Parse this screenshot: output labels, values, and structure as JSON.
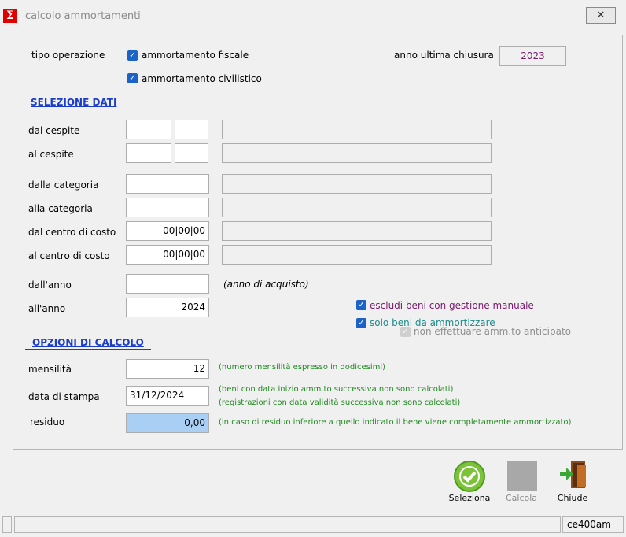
{
  "window": {
    "title": "calcolo ammortamenti",
    "icon_glyph": "Σ",
    "close_glyph": "✕"
  },
  "tipo_operazione": {
    "label": "tipo operazione",
    "fiscale": {
      "label": "ammortamento fiscale",
      "checked": true
    },
    "civilistico": {
      "label": "ammortamento civilistico",
      "checked": true
    }
  },
  "anno_ultima_chiusura": {
    "label": "anno ultima chiusura",
    "value": "2023"
  },
  "selezione_dati": {
    "title": "SELEZIONE DATI",
    "dal_cespite": {
      "label": "dal cespite",
      "value1": "",
      "value2": ""
    },
    "al_cespite": {
      "label": "al cespite",
      "value1": "",
      "value2": ""
    },
    "dalla_categoria": {
      "label": "dalla categoria",
      "value": ""
    },
    "alla_categoria": {
      "label": "alla categoria",
      "value": ""
    },
    "dal_centro_costo": {
      "label": "dal centro di costo",
      "value": "00|00|00"
    },
    "al_centro_costo": {
      "label": "al centro di costo",
      "value": "00|00|00"
    },
    "dall_anno": {
      "label": "dall'anno",
      "value": "",
      "hint": "(anno di acquisto)"
    },
    "all_anno": {
      "label": "all'anno",
      "value": "2024"
    },
    "escludi_manuale": {
      "label": "escludi beni con gestione manuale",
      "checked": true
    },
    "solo_ammortizzare": {
      "label": "solo beni da ammortizzare",
      "checked": true
    },
    "non_anticipato": {
      "label": "non effettuare amm.to anticipato",
      "checked": true,
      "disabled": true
    }
  },
  "opzioni_calcolo": {
    "title": "OPZIONI DI CALCOLO",
    "mensilita": {
      "label": "mensilità",
      "value": "12",
      "note": "(numero mensilità espresso in dodicesimi)"
    },
    "data_stampa": {
      "label": "data di stampa",
      "value": "31/12/2024",
      "note1": "(beni con data inizio amm.to successiva non sono calcolati)",
      "note2": "(registrazioni con data validità successiva non sono calcolati)"
    },
    "residuo": {
      "label": "residuo",
      "value": "0,00",
      "note": "(in caso di residuo inferiore a quello indicato il bene viene completamente ammortizzato)"
    }
  },
  "toolbar": {
    "seleziona": "Seleziona",
    "calcola": "Calcola",
    "chiude": "Chiude"
  },
  "status": {
    "code": "ce400am"
  },
  "colors": {
    "accent": "#1b63c6",
    "section": "#1a3ec8",
    "note": "#1f8a1f",
    "purple": "#7a1a6e",
    "residuo_bg": "#a9cff5"
  }
}
